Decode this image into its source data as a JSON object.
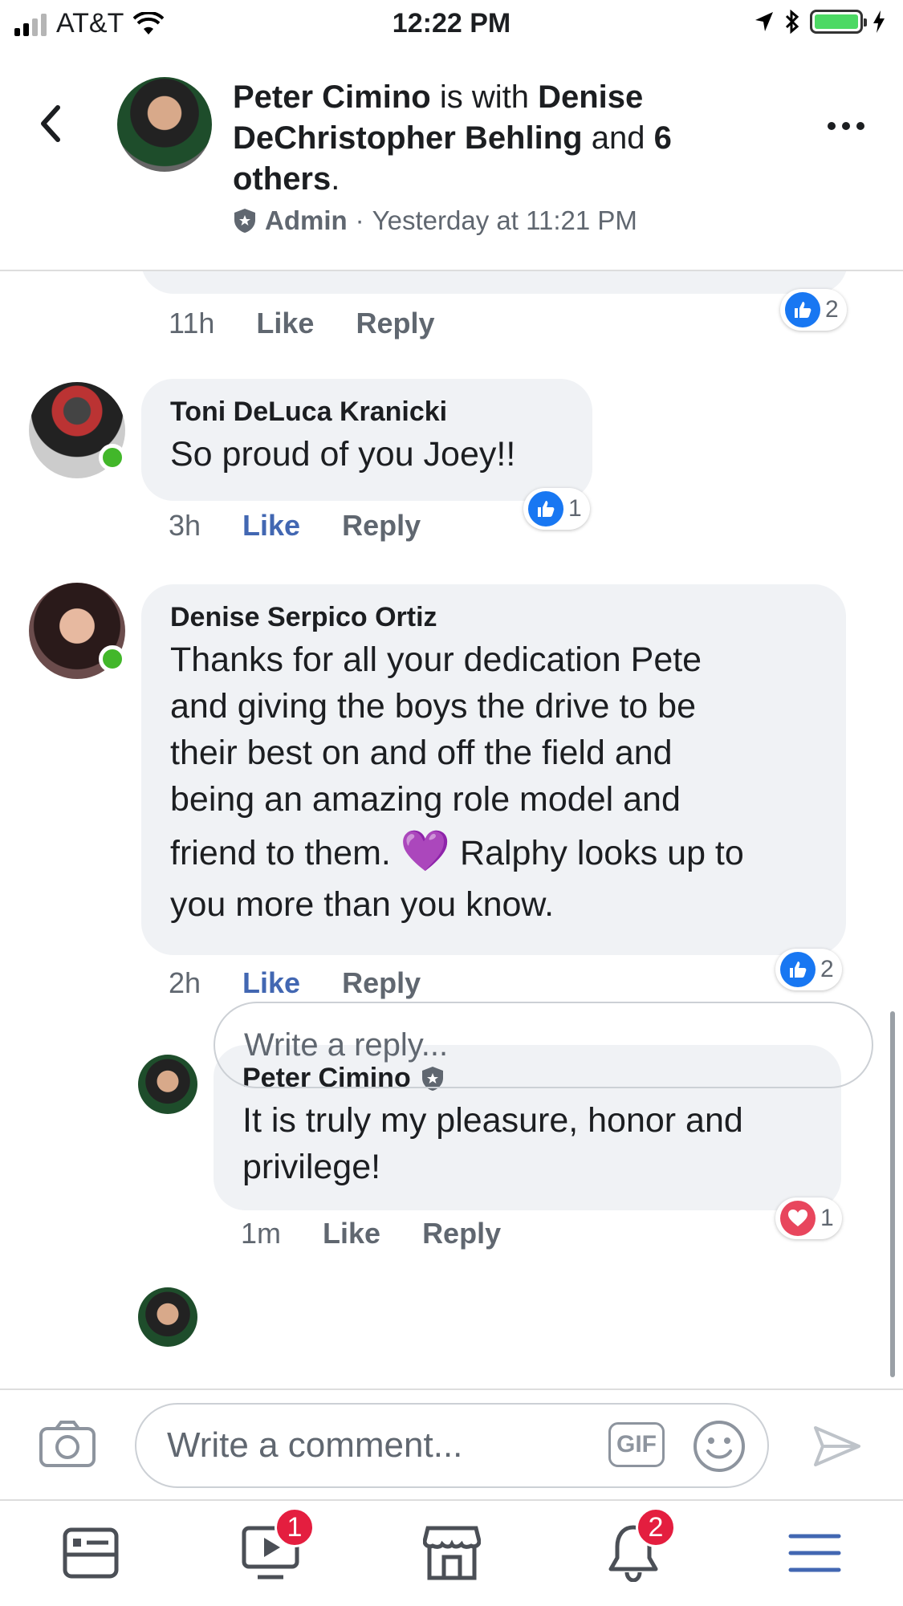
{
  "status_bar": {
    "carrier": "AT&T",
    "time": "12:22 PM"
  },
  "header": {
    "author": "Peter Cimino",
    "connector": " is with ",
    "tagged": "Denise DeChristopher Behling",
    "connector2": " and ",
    "others": "6 others",
    "end": ".",
    "role": "Admin",
    "separator": "·",
    "timestamp": "Yesterday at 11:21 PM"
  },
  "comments": [
    {
      "time": "11h",
      "like_label": "Like",
      "reply_label": "Reply",
      "reaction_count": "2"
    },
    {
      "author": "Toni DeLuca Kranicki",
      "text": "So proud of you Joey!!",
      "time": "3h",
      "like_label": "Like",
      "reply_label": "Reply",
      "reaction_count": "1"
    },
    {
      "author": "Denise Serpico Ortiz",
      "text_line1": "Thanks for all your dedication Pete",
      "text_line2": "and giving the boys the drive to be",
      "text_line3": "their best on and off the field and",
      "text_line4": "being an amazing role model and",
      "text_line5a": "friend to them. ",
      "emoji": "💜",
      "text_line5b": " Ralphy looks up to",
      "text_line6": "you more than you know.",
      "time": "2h",
      "like_label": "Like",
      "reply_label": "Reply",
      "reaction_count": "2"
    }
  ],
  "reply": {
    "author": "Peter Cimino",
    "text_line1": "It is truly my pleasure, honor and",
    "text_line2": "privilege!",
    "time": "1m",
    "like_label": "Like",
    "reply_label": "Reply",
    "reaction_count": "1"
  },
  "reply_box": {
    "placeholder": "Write a reply..."
  },
  "composer": {
    "placeholder": "Write a comment...",
    "gif_label": "GIF"
  },
  "tabbar": {
    "watch_badge": "1",
    "notifications_badge": "2"
  },
  "colors": {
    "accent": "#4267b2",
    "like": "#1877f2",
    "love": "#e8465d",
    "online": "#42b72a",
    "badge": "#e41e3f"
  }
}
